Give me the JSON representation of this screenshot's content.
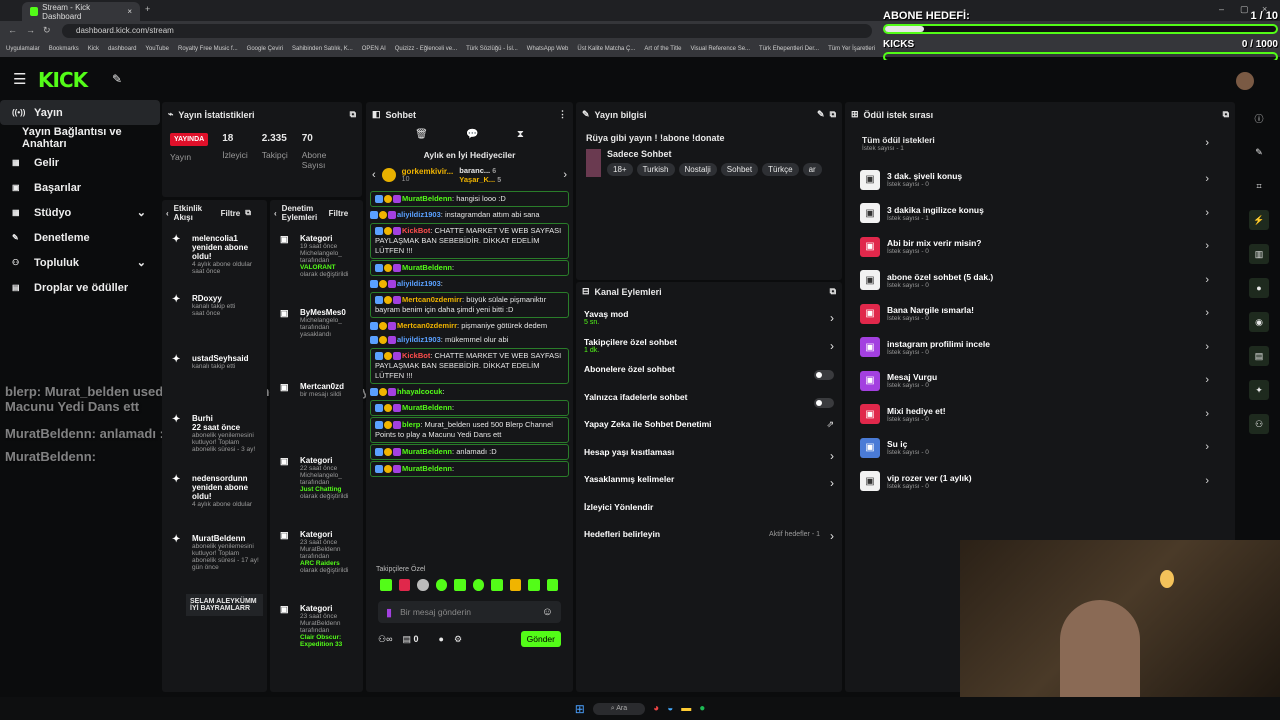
{
  "browser": {
    "tab_title": "Stream - Kick Dashboard",
    "url": "dashboard.kick.com/stream",
    "bookmarks": [
      "Uygulamalar",
      "Bookmarks",
      "Kick",
      "dashboard",
      "YouTube",
      "Royalty Free Music f...",
      "Google Çeviri",
      "Sahibinden Satılık, K...",
      "OPEN AI",
      "Quizizz - Eğlenceli ve...",
      "Türk Sözlüğü - İsl...",
      "WhatsApp Web",
      "Üst Kalite Matcha Ç...",
      "Art of the Title",
      "Visual Reference Se...",
      "Türk Ehepentleri Der...",
      "Tüm Yer İşaretleri"
    ]
  },
  "overlay": {
    "goal_title": "ABONE HEDEFİ:",
    "goal_count": "1 / 10",
    "goal_progress": 0.1,
    "kicks_label": "KICKS",
    "kicks_count": "0 / 1000",
    "kicks_progress": 0.0,
    "ticker": [
      "blerp: Murat_belden used 500 Blerp Channel Points to play a Macunu Yedi Dans ett",
      "MuratBeldenn: anlamadı :D",
      "MuratBeldenn:"
    ]
  },
  "nav": {
    "items": [
      {
        "label": "Yayın",
        "icon": "broadcast-icon",
        "active": true
      },
      {
        "label": "Yayın Bağlantısı ve Anahtarı",
        "icon": "",
        "active": false
      },
      {
        "label": "Gelir",
        "icon": "money-icon",
        "active": false
      },
      {
        "label": "Başarılar",
        "icon": "trophy-icon",
        "active": false
      },
      {
        "label": "Stüdyo",
        "icon": "studio-icon",
        "active": false
      },
      {
        "label": "Denetleme",
        "icon": "hammer-icon",
        "active": false
      },
      {
        "label": "Topluluk",
        "icon": "people-icon",
        "active": false
      },
      {
        "label": "Droplar ve ödüller",
        "icon": "gift-icon",
        "active": false
      }
    ]
  },
  "stats": {
    "title": "Yayın İstatistikleri",
    "live": "YAYINDA",
    "live_label": "Yayın",
    "viewers": "18",
    "viewers_label": "İzleyici",
    "followers": "2.335",
    "followers_label": "Takipçi",
    "subs": "70",
    "subs_label": "Abone Sayısı"
  },
  "activity": {
    "title": "Etkinlik Akışı",
    "filter": "Filtre",
    "items": [
      {
        "name": "melencolia1",
        "text": "yeniden abone oldu!",
        "time": "saat önce",
        "detail": "4 aylık abone oldular"
      },
      {
        "name": "RDoxyy",
        "text": "",
        "time": "saat önce",
        "detail": "kanalı takip etti"
      },
      {
        "name": "ustadSeyhsaid",
        "text": "",
        "time": "",
        "detail": "kanalı takip etti"
      },
      {
        "name": "Burhi",
        "text": "22 saat önce",
        "time": "",
        "detail": "abonelik yenilemesini kutluyor! Toplam abonelik süresi - 3 ay!"
      },
      {
        "name": "nedensordunn",
        "text": "yeniden abone oldu!",
        "time": "",
        "detail": "4 aylık abone oldular"
      },
      {
        "name": "MuratBeldenn",
        "text": "",
        "time": "gün önce",
        "detail": "abonelik yenilemesini kutluyor! Toplam abonelik süresi - 17 ay!"
      }
    ],
    "message": "SELAM ALEYKÜMM İYİ BAYRAMLARR"
  },
  "modlog": {
    "title": "Denetim Eylemleri",
    "filter": "Filtre",
    "items": [
      {
        "kind": "Kategori",
        "time": "19 saat önce",
        "detail": "Michelangelo_ tarafından",
        "value": "VALORANT",
        "suffix": "olarak değiştirildi"
      },
      {
        "kind": "ByMesMes0",
        "time": "",
        "detail": "Michelangelo_ tarafından yasaklandı",
        "value": "",
        "suffix": ""
      },
      {
        "kind": "Mertcan0zd",
        "time": "",
        "detail": "bir mesajı sildi",
        "value": "",
        "suffix": ""
      },
      {
        "kind": "Kategori",
        "time": "22 saat önce",
        "detail": "Michelangelo_ tarafından",
        "value": "Just Chatting",
        "suffix": "olarak değiştirildi"
      },
      {
        "kind": "Kategori",
        "time": "23 saat önce",
        "detail": "MuratBeldenn tarafından",
        "value": "ARC Raiders",
        "suffix": "olarak değiştirildi"
      },
      {
        "kind": "Kategori",
        "time": "23 saat önce",
        "detail": "MuratBeldenn tarafından",
        "value": "Clair Obscur: Expedition 33",
        "suffix": ""
      }
    ]
  },
  "chat": {
    "title": "Sohbet",
    "gifters_title": "Aylık en İyi Hediyeciler",
    "gifters": [
      {
        "name": "gorkemkivir...",
        "count": "10"
      },
      {
        "name": "baranc...",
        "count": "6"
      },
      {
        "name": "Yaşar_K...",
        "count": "5"
      }
    ],
    "messages": [
      {
        "user": "MuratBeldenn",
        "cls": "",
        "text": "hangisi looo :D",
        "boxed": true
      },
      {
        "user": "aliyildiz1903",
        "cls": "blue",
        "text": "instagramdan attım abi sana",
        "boxed": false
      },
      {
        "user": "KickBot",
        "cls": "red",
        "text": "CHATTE MARKET VE WEB SAYFASI PAYLAŞMAK BAN SEBEBİDİR. DİKKAT EDELİM LÜTFEN !!!",
        "boxed": true
      },
      {
        "user": "MuratBeldenn",
        "cls": "",
        "text": "",
        "boxed": true
      },
      {
        "user": "aliyildiz1903",
        "cls": "blue",
        "text": "",
        "boxed": false
      },
      {
        "user": "Mertcan0zdemirr",
        "cls": "org",
        "text": "büyük sülale pişmaniktır bayram benim için daha şimdi yeni bitti :D",
        "boxed": true
      },
      {
        "user": "Mertcan0zdemirr",
        "cls": "org",
        "text": "pişmaniye götürek dedem",
        "boxed": false
      },
      {
        "user": "aliyildiz1903",
        "cls": "blue",
        "text": "mükemmel olur abi",
        "boxed": false
      },
      {
        "user": "KickBot",
        "cls": "red",
        "text": "CHATTE MARKET VE WEB SAYFASI PAYLAŞMAK BAN SEBEBİDİR. DİKKAT EDELİM LÜTFEN !!!",
        "boxed": true
      },
      {
        "user": "hhayalcocuk",
        "cls": "",
        "text": "",
        "boxed": false
      },
      {
        "user": "MuratBeldenn",
        "cls": "",
        "text": "",
        "boxed": true
      },
      {
        "user": "blerp",
        "cls": "",
        "text": "Murat_belden used 500 Blerp Channel Points to play a Macunu Yedi Dans ett",
        "boxed": true
      },
      {
        "user": "MuratBeldenn",
        "cls": "",
        "text": "anlamadı :D",
        "boxed": true
      },
      {
        "user": "MuratBeldenn",
        "cls": "",
        "text": "",
        "boxed": true
      }
    ],
    "follower_only": "Takipçilere Özel",
    "placeholder": "Bir mesaj gönderin",
    "points": "0",
    "send": "Gönder"
  },
  "info": {
    "title": "Yayın bilgisi",
    "stream_title": "Rüya gibi yayın ! !abone !donate",
    "category": "Sadece Sohbet",
    "tags": [
      "18+",
      "Turkish",
      "Nostalji",
      "Sohbet",
      "Türkçe",
      "ar"
    ]
  },
  "actions": {
    "title": "Kanal Eylemleri",
    "items": [
      {
        "label": "Yavaş mod",
        "sub": "5 sn.",
        "ctl": "chevron"
      },
      {
        "label": "Takipçilere özel sohbet",
        "sub": "1 dk.",
        "ctl": "chevron"
      },
      {
        "label": "Abonelere özel sohbet",
        "sub": "",
        "ctl": "toggle"
      },
      {
        "label": "Yalnızca ifadelerle sohbet",
        "sub": "",
        "ctl": "toggle"
      },
      {
        "label": "Yapay Zeka ile Sohbet Denetimi",
        "sub": "",
        "ctl": "ext"
      },
      {
        "label": "Hesap yaşı kısıtlaması",
        "sub": "",
        "ctl": "chevron"
      },
      {
        "label": "Yasaklanmış kelimeler",
        "sub": "",
        "ctl": "chevron"
      },
      {
        "label": "İzleyici Yönlendir",
        "sub": "",
        "ctl": "none"
      },
      {
        "label": "Hedefleri belirleyin",
        "sub": "",
        "ctl": "goal",
        "extra": "Aktif hedefler - 1"
      }
    ]
  },
  "rewards": {
    "title": "Ödül istek sırası",
    "all": "Tüm ödül istekleri",
    "all_sub": "İstek sayısı - 1",
    "items": [
      {
        "label": "3 dak. şiveli konuş",
        "sub": "İstek sayısı - 0",
        "color": "#f2f2f2"
      },
      {
        "label": "3 dakika ingilizce konuş",
        "sub": "İstek sayısı - 1",
        "color": "#f2f2f2"
      },
      {
        "label": "Abi bir mix verir misin?",
        "sub": "İstek sayısı - 0",
        "color": "#e0284b"
      },
      {
        "label": "abone özel sohbet (5 dak.)",
        "sub": "İstek sayısı - 0",
        "color": "#f2f2f2"
      },
      {
        "label": "Bana Nargile ısmarla!",
        "sub": "İstek sayısı - 0",
        "color": "#e0284b"
      },
      {
        "label": "instagram profilimi incele",
        "sub": "İstek sayısı - 0",
        "color": "#a340e0"
      },
      {
        "label": "Mesaj Vurgu",
        "sub": "İstek sayısı - 0",
        "color": "#a340e0"
      },
      {
        "label": "Mixi hediye et!",
        "sub": "İstek sayısı - 0",
        "color": "#e0284b"
      },
      {
        "label": "Su iç",
        "sub": "İstek sayısı - 0",
        "color": "#4a7bd6"
      },
      {
        "label": "vip rozer ver (1 aylık)",
        "sub": "İstek sayısı - 0",
        "color": "#f2f2f2"
      }
    ]
  },
  "taskbar": {
    "search": "Ara"
  }
}
